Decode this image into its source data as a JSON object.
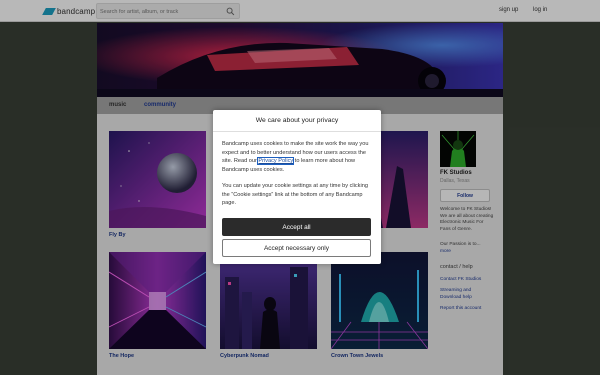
{
  "header": {
    "logo_text": "bandcamp",
    "search_placeholder": "Search for artist, album, or track",
    "search_icon": "search-icon",
    "signup_label": "sign up",
    "login_label": "log in"
  },
  "tabs": {
    "music": "music",
    "community": "community"
  },
  "albums": [
    {
      "title": "Fly By"
    },
    {
      "title": "The Hope"
    },
    {
      "title": "Cyberpunk Nomad"
    },
    {
      "title": "Crown Town Jewels"
    }
  ],
  "sidebar": {
    "band_name": "FK Studios",
    "location": "Dallas, Texas",
    "follow_label": "Follow",
    "bio": "Welcome to FK Studios! We are all about creating Electronic Music For Fans of Genre.",
    "bio2": "Our Passion is to...",
    "more_label": "more",
    "contact_heading": "contact / help",
    "links": {
      "contact": "Contact FK Studios",
      "streaming": "Streaming and Download help",
      "report": "Report this account"
    }
  },
  "cookie_dialog": {
    "title": "We care about your privacy",
    "para1_before": "Bandcamp uses cookies to make the site work the way you expect and to better understand how our users access the site. Read our ",
    "policy_link": "Privacy Policy",
    "para1_after": " to learn more about how Bandcamp uses cookies.",
    "para2": "You can update your cookie settings at any time by clicking the “Cookie settings” link at the bottom of any Bandcamp page.",
    "accept_all": "Accept all",
    "accept_necessary": "Accept necessary only"
  },
  "colors": {
    "accent": "#1da0c3",
    "link": "#1f3a94",
    "background": "#3a4137"
  }
}
